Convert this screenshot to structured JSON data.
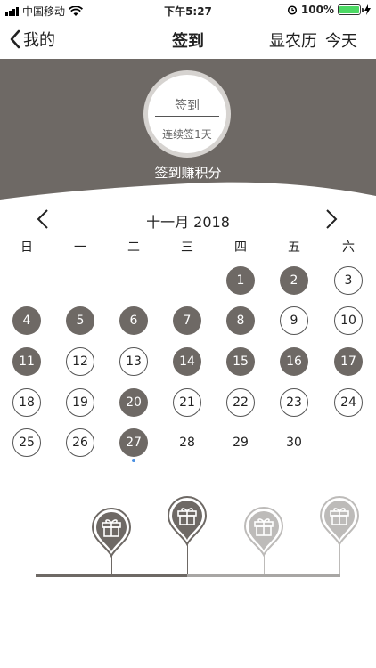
{
  "status": {
    "carrier": "中国移动",
    "time": "下午5:27",
    "battery": "100%",
    "battery_level": 1.0
  },
  "nav": {
    "back_label": "我的",
    "title": "签到",
    "lunar_label": "显农历",
    "today_label": "今天"
  },
  "sign": {
    "button_label": "签到",
    "streak_label": "连续签1天",
    "earn_label": "签到赚积分"
  },
  "calendar": {
    "month_label": "十一月 2018",
    "weekdays": [
      "日",
      "一",
      "二",
      "三",
      "四",
      "五",
      "六"
    ],
    "days": [
      {
        "n": "1",
        "state": "signed"
      },
      {
        "n": "2",
        "state": "signed"
      },
      {
        "n": "3",
        "state": "open"
      },
      {
        "n": "4",
        "state": "signed"
      },
      {
        "n": "5",
        "state": "signed"
      },
      {
        "n": "6",
        "state": "signed"
      },
      {
        "n": "7",
        "state": "signed"
      },
      {
        "n": "8",
        "state": "signed"
      },
      {
        "n": "9",
        "state": "open"
      },
      {
        "n": "10",
        "state": "open"
      },
      {
        "n": "11",
        "state": "signed"
      },
      {
        "n": "12",
        "state": "open"
      },
      {
        "n": "13",
        "state": "open"
      },
      {
        "n": "14",
        "state": "signed"
      },
      {
        "n": "15",
        "state": "signed"
      },
      {
        "n": "16",
        "state": "signed"
      },
      {
        "n": "17",
        "state": "signed"
      },
      {
        "n": "18",
        "state": "open"
      },
      {
        "n": "19",
        "state": "open"
      },
      {
        "n": "20",
        "state": "signed"
      },
      {
        "n": "21",
        "state": "open"
      },
      {
        "n": "22",
        "state": "open"
      },
      {
        "n": "23",
        "state": "open"
      },
      {
        "n": "24",
        "state": "open"
      },
      {
        "n": "25",
        "state": "open"
      },
      {
        "n": "26",
        "state": "open"
      },
      {
        "n": "27",
        "state": "signed",
        "today": true
      },
      {
        "n": "28",
        "state": "plain"
      },
      {
        "n": "29",
        "state": "plain"
      },
      {
        "n": "30",
        "state": "plain"
      }
    ]
  },
  "rewards": [
    {
      "icon": "gift-icon",
      "state": "achieved"
    },
    {
      "icon": "gift-icon",
      "state": "achieved"
    },
    {
      "icon": "gift-icon",
      "state": "locked"
    },
    {
      "icon": "gift-icon",
      "state": "locked"
    }
  ],
  "colors": {
    "accent": "#6e6965",
    "locked": "#bdbbb9",
    "today_dot": "#4a90e2",
    "battery": "#4cd964"
  }
}
